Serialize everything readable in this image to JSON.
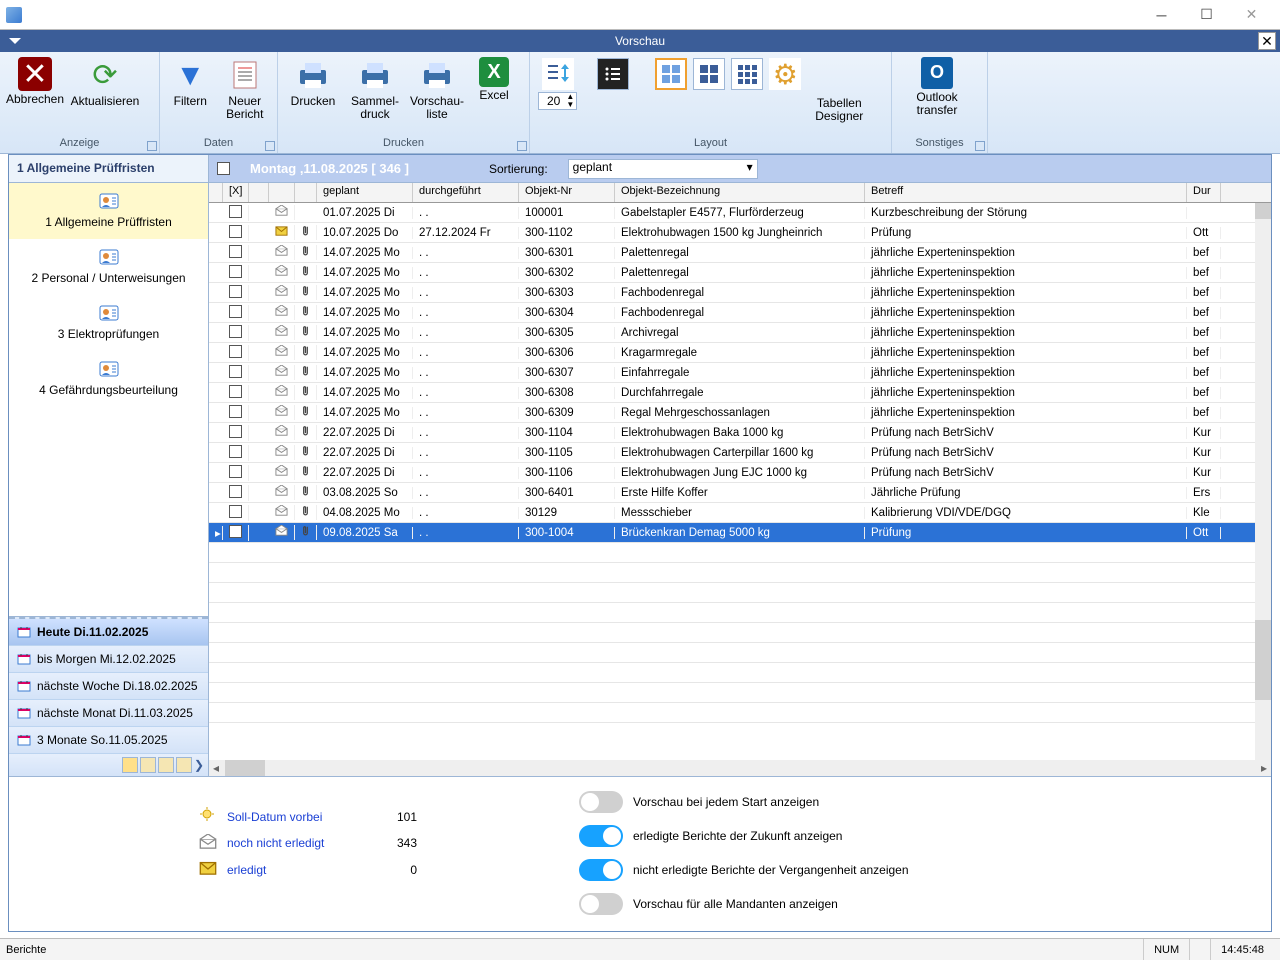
{
  "window": {
    "title_inner": "Vorschau"
  },
  "ribbon": {
    "groups": {
      "anzeige": {
        "label": "Anzeige",
        "abbrechen": "Abbrechen",
        "aktualisieren": "Aktualisieren"
      },
      "daten": {
        "label": "Daten",
        "filtern": "Filtern",
        "neuer_bericht": "Neuer\nBericht"
      },
      "drucken": {
        "label": "Drucken",
        "drucken": "Drucken",
        "sammeldruck": "Sammel-\ndruck",
        "vorschauliste": "Vorschau-\nliste",
        "excel": "Excel"
      },
      "layout": {
        "label": "Layout",
        "spinner_value": "20",
        "tabellendesigner": "Tabellen\nDesigner"
      },
      "sonstiges": {
        "label": "Sonstiges",
        "outlook_transfer": "Outlook\ntransfer"
      }
    }
  },
  "filterbar": {
    "heading": "Montag ,11.08.2025  [ 346 ]",
    "sort_label": "Sortierung:",
    "sort_value": "geplant"
  },
  "sidebar": {
    "title": "1 Allgemeine Prüffristen",
    "categories": [
      {
        "label": "1 Allgemeine Prüffristen",
        "selected": true
      },
      {
        "label": "2 Personal / Unterweisungen",
        "selected": false
      },
      {
        "label": "3 Elektroprüfungen",
        "selected": false
      },
      {
        "label": "4 Gefährdungsbeurteilung",
        "selected": false
      }
    ],
    "date_ranges": [
      "Heute Di.11.02.2025",
      "bis Morgen Mi.12.02.2025",
      "nächste Woche Di.18.02.2025",
      "nächste Monat Di.11.03.2025",
      "3 Monate So.11.05.2025"
    ]
  },
  "grid": {
    "columns": {
      "chk_header": "[X]",
      "geplant": "geplant",
      "durchgefuehrt": "durchgeführt",
      "objekt_nr": "Objekt-Nr",
      "objekt_bez": "Objekt-Bezeichnung",
      "betreff": "Betreff",
      "durchf": "Dur"
    },
    "rows": [
      {
        "env": "open",
        "att": false,
        "geplant": "01.07.2025 Di",
        "durchf": ". .",
        "objnr": "100001",
        "bez": "Gabelstapler E4577, Flurförderzeug",
        "bet": "Kurzbeschreibung der Störung",
        "d": ""
      },
      {
        "env": "closed",
        "att": true,
        "geplant": "10.07.2025 Do",
        "durchf": "27.12.2024 Fr",
        "objnr": "300-1102",
        "bez": "Elektrohubwagen 1500 kg  Jungheinrich",
        "bet": "Prüfung",
        "d": "Ott"
      },
      {
        "env": "open",
        "att": true,
        "geplant": "14.07.2025 Mo",
        "durchf": ". .",
        "objnr": "300-6301",
        "bez": "Palettenregal",
        "bet": "jährliche Experteninspektion",
        "d": "bef"
      },
      {
        "env": "open",
        "att": true,
        "geplant": "14.07.2025 Mo",
        "durchf": ". .",
        "objnr": "300-6302",
        "bez": "Palettenregal",
        "bet": "jährliche Experteninspektion",
        "d": "bef"
      },
      {
        "env": "open",
        "att": true,
        "geplant": "14.07.2025 Mo",
        "durchf": ". .",
        "objnr": "300-6303",
        "bez": "Fachbodenregal",
        "bet": "jährliche Experteninspektion",
        "d": "bef"
      },
      {
        "env": "open",
        "att": true,
        "geplant": "14.07.2025 Mo",
        "durchf": ". .",
        "objnr": "300-6304",
        "bez": "Fachbodenregal",
        "bet": "jährliche Experteninspektion",
        "d": "bef"
      },
      {
        "env": "open",
        "att": true,
        "geplant": "14.07.2025 Mo",
        "durchf": ". .",
        "objnr": "300-6305",
        "bez": "Archivregal",
        "bet": "jährliche Experteninspektion",
        "d": "bef"
      },
      {
        "env": "open",
        "att": true,
        "geplant": "14.07.2025 Mo",
        "durchf": ". .",
        "objnr": "300-6306",
        "bez": "Kragarmregale",
        "bet": "jährliche Experteninspektion",
        "d": "bef"
      },
      {
        "env": "open",
        "att": true,
        "geplant": "14.07.2025 Mo",
        "durchf": ". .",
        "objnr": "300-6307",
        "bez": "Einfahrregale",
        "bet": "jährliche Experteninspektion",
        "d": "bef"
      },
      {
        "env": "open",
        "att": true,
        "geplant": "14.07.2025 Mo",
        "durchf": ". .",
        "objnr": "300-6308",
        "bez": "Durchfahrregale",
        "bet": "jährliche Experteninspektion",
        "d": "bef"
      },
      {
        "env": "open",
        "att": true,
        "geplant": "14.07.2025 Mo",
        "durchf": ". .",
        "objnr": "300-6309",
        "bez": "Regal Mehrgeschossanlagen",
        "bet": "jährliche Experteninspektion",
        "d": "bef"
      },
      {
        "env": "open",
        "att": true,
        "geplant": "22.07.2025 Di",
        "durchf": ". .",
        "objnr": "300-1104",
        "bez": "Elektrohubwagen Baka 1000 kg",
        "bet": "Prüfung nach BetrSichV",
        "d": "Kur"
      },
      {
        "env": "open",
        "att": true,
        "geplant": "22.07.2025 Di",
        "durchf": ". .",
        "objnr": "300-1105",
        "bez": "Elektrohubwagen Carterpillar 1600 kg",
        "bet": "Prüfung nach BetrSichV",
        "d": "Kur"
      },
      {
        "env": "open",
        "att": true,
        "geplant": "22.07.2025 Di",
        "durchf": ". .",
        "objnr": "300-1106",
        "bez": "Elektrohubwagen Jung EJC 1000 kg",
        "bet": "Prüfung nach BetrSichV",
        "d": "Kur"
      },
      {
        "env": "open",
        "att": true,
        "geplant": "03.08.2025 So",
        "durchf": ". .",
        "objnr": "300-6401",
        "bez": "Erste Hilfe Koffer",
        "bet": "Jährliche Prüfung",
        "d": "Ers"
      },
      {
        "env": "open",
        "att": true,
        "geplant": "04.08.2025 Mo",
        "durchf": ". .",
        "objnr": "30129",
        "bez": "Messschieber",
        "bet": "Kalibrierung VDI/VDE/DGQ",
        "d": "Kle"
      },
      {
        "env": "open",
        "att": true,
        "geplant": "09.08.2025 Sa",
        "durchf": ". .",
        "objnr": "300-1004",
        "bez": "Brückenkran Demag 5000 kg",
        "bet": "Prüfung",
        "d": "Ott",
        "selected": true
      }
    ]
  },
  "footer": {
    "legend": [
      {
        "icon": "bulb",
        "text": "Soll-Datum vorbei",
        "num": "101"
      },
      {
        "icon": "env-open",
        "text": "noch nicht erledigt",
        "num": "343"
      },
      {
        "icon": "env-closed",
        "text": "erledigt",
        "num": "0"
      }
    ],
    "toggles": [
      {
        "on": false,
        "text": "Vorschau bei jedem Start anzeigen"
      },
      {
        "on": true,
        "text": "erledigte Berichte der Zukunft anzeigen"
      },
      {
        "on": true,
        "text": "nicht erledigte Berichte der Vergangenheit anzeigen"
      },
      {
        "on": false,
        "text": "Vorschau für alle Mandanten anzeigen"
      }
    ]
  },
  "statusbar": {
    "left": "Berichte",
    "num": "NUM",
    "time": "14:45:48"
  }
}
